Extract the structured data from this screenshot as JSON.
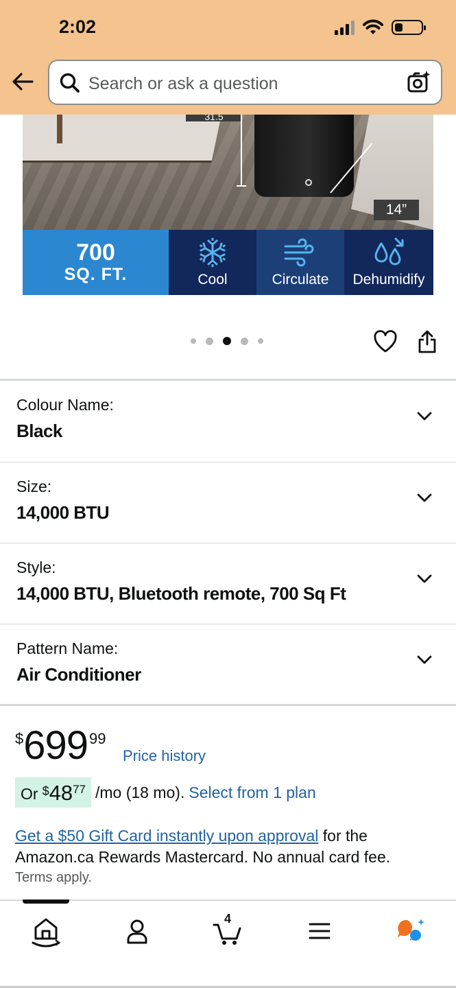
{
  "status_bar": {
    "time": "2:02"
  },
  "search": {
    "placeholder": "Search or ask a question"
  },
  "product_image": {
    "dimension_depth": "14”",
    "dimension_height_partial": "31.5",
    "features": {
      "area_value": "700",
      "area_unit": "SQ. FT.",
      "modes": [
        "Cool",
        "Circulate",
        "Dehumidify"
      ]
    }
  },
  "carousel": {
    "total": 5,
    "active": 3
  },
  "variations": [
    {
      "label": "Colour Name:",
      "value": "Black"
    },
    {
      "label": "Size:",
      "value": "14,000 BTU"
    },
    {
      "label": "Style:",
      "value": "14,000 BTU, Bluetooth remote, 700 Sq Ft"
    },
    {
      "label": "Pattern Name:",
      "value": "Air Conditioner"
    }
  ],
  "price": {
    "symbol": "$",
    "whole": "699",
    "fraction": "99",
    "history_link": "Price history"
  },
  "installment": {
    "prefix": "Or",
    "symbol": "$",
    "whole": "48",
    "fraction": "77",
    "term": "/mo (18 mo).",
    "link": "Select from 1 plan"
  },
  "promo": {
    "link": "Get a $50 Gift Card instantly upon approval",
    "text": " for the Amazon.ca Rewards Mastercard. No annual card fee.",
    "terms": "Terms apply."
  },
  "bottom_nav": {
    "cart_count": "4",
    "items": [
      "home-icon",
      "account-icon",
      "cart-icon",
      "menu-icon",
      "rufus-ai-icon"
    ]
  },
  "colors": {
    "header_bg": "#f4c38e",
    "link": "#2162a1",
    "installment_bg": "#d3f3e6",
    "feature_area_bg": "#2b87d0",
    "feature_dark_bg": "#12275a",
    "ai_orange": "#f0711f",
    "ai_blue": "#1e90e8"
  }
}
